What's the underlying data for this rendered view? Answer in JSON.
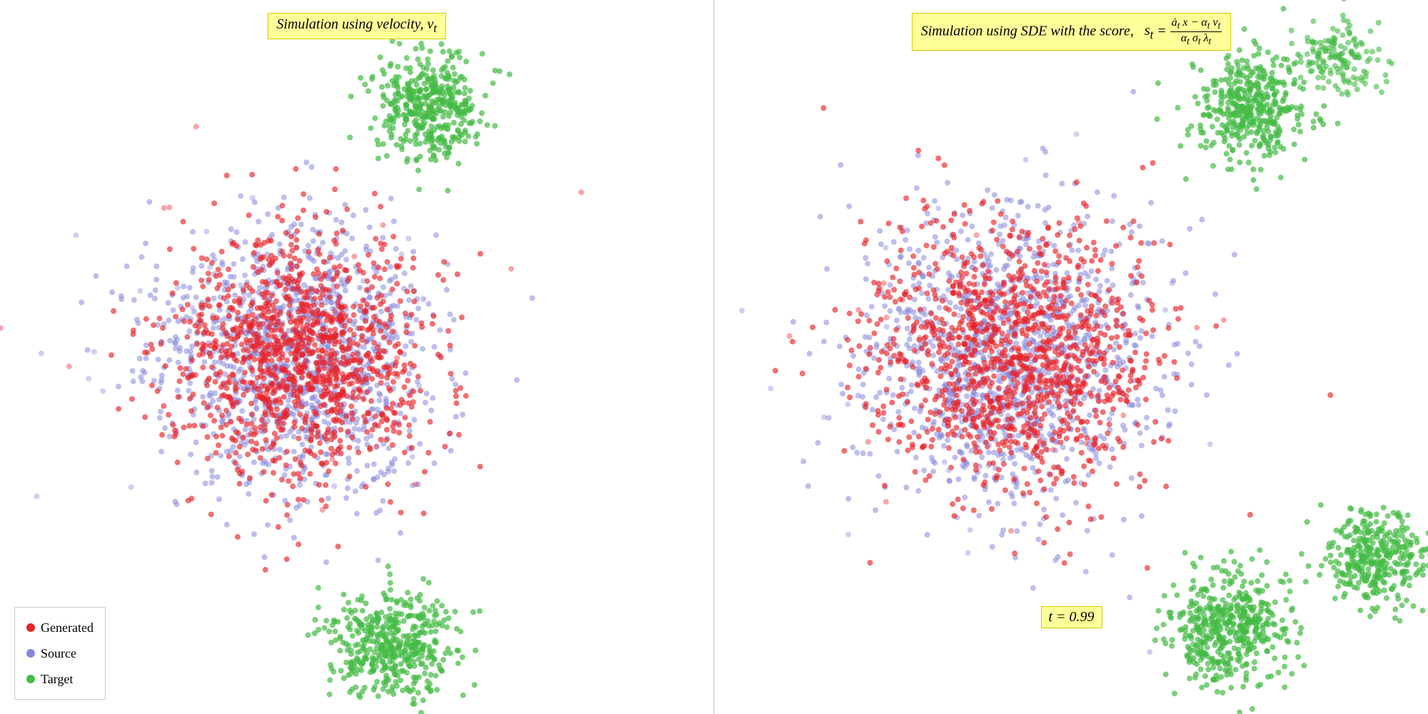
{
  "panel1": {
    "title": "Simulation using velocity, v",
    "title_sub": "t",
    "canvas_id": "canvas1"
  },
  "panel2": {
    "title": "Simulation using SDE with the score,",
    "formula": "s_t = (ȧ_t x − α_t v_t) / (α_t σ_t λ_t)",
    "canvas_id": "canvas2",
    "t_label": "t = 0.99"
  },
  "legend": {
    "items": [
      {
        "label": "Generated",
        "color": "#e8232a"
      },
      {
        "label": "Source",
        "color": "#8888dd"
      },
      {
        "label": "Target",
        "color": "#44bb44"
      }
    ]
  },
  "colors": {
    "generated": "#e8232a",
    "source": "#8888dd",
    "target": "#44bb44",
    "title_bg": "#ffff99"
  }
}
